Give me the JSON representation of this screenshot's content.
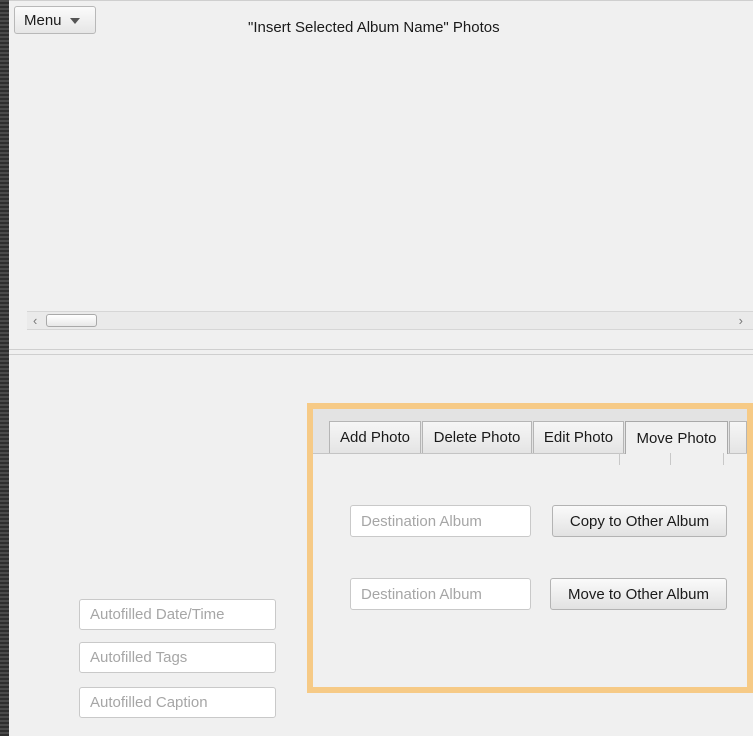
{
  "header": {
    "menu_label": "Menu",
    "title": "\"Insert Selected Album Name\" Photos"
  },
  "icons": {
    "menu_caret": "chevron-down-icon",
    "scroll_left": "chevron-left-icon",
    "scroll_right": "chevron-right-icon"
  },
  "scrollbar": {
    "left_arrow": "‹",
    "right_arrow": "›"
  },
  "details": {
    "date_placeholder": "Autofilled Date/Time",
    "tags_placeholder": "Autofilled Tags",
    "caption_placeholder": "Autofilled Caption"
  },
  "tabs": {
    "items": [
      {
        "label": "Add Photo",
        "selected": false
      },
      {
        "label": "Delete Photo",
        "selected": false
      },
      {
        "label": "Edit Photo",
        "selected": false
      },
      {
        "label": "Move Photo",
        "selected": true
      }
    ]
  },
  "move_panel": {
    "copy_destination_placeholder": "Destination Album",
    "copy_button_label": "Copy to Other Album",
    "move_destination_placeholder": "Destination Album",
    "move_button_label": "Move to Other Album"
  },
  "colors": {
    "highlight_border": "#f6ca86",
    "background": "#f0f0f0"
  }
}
